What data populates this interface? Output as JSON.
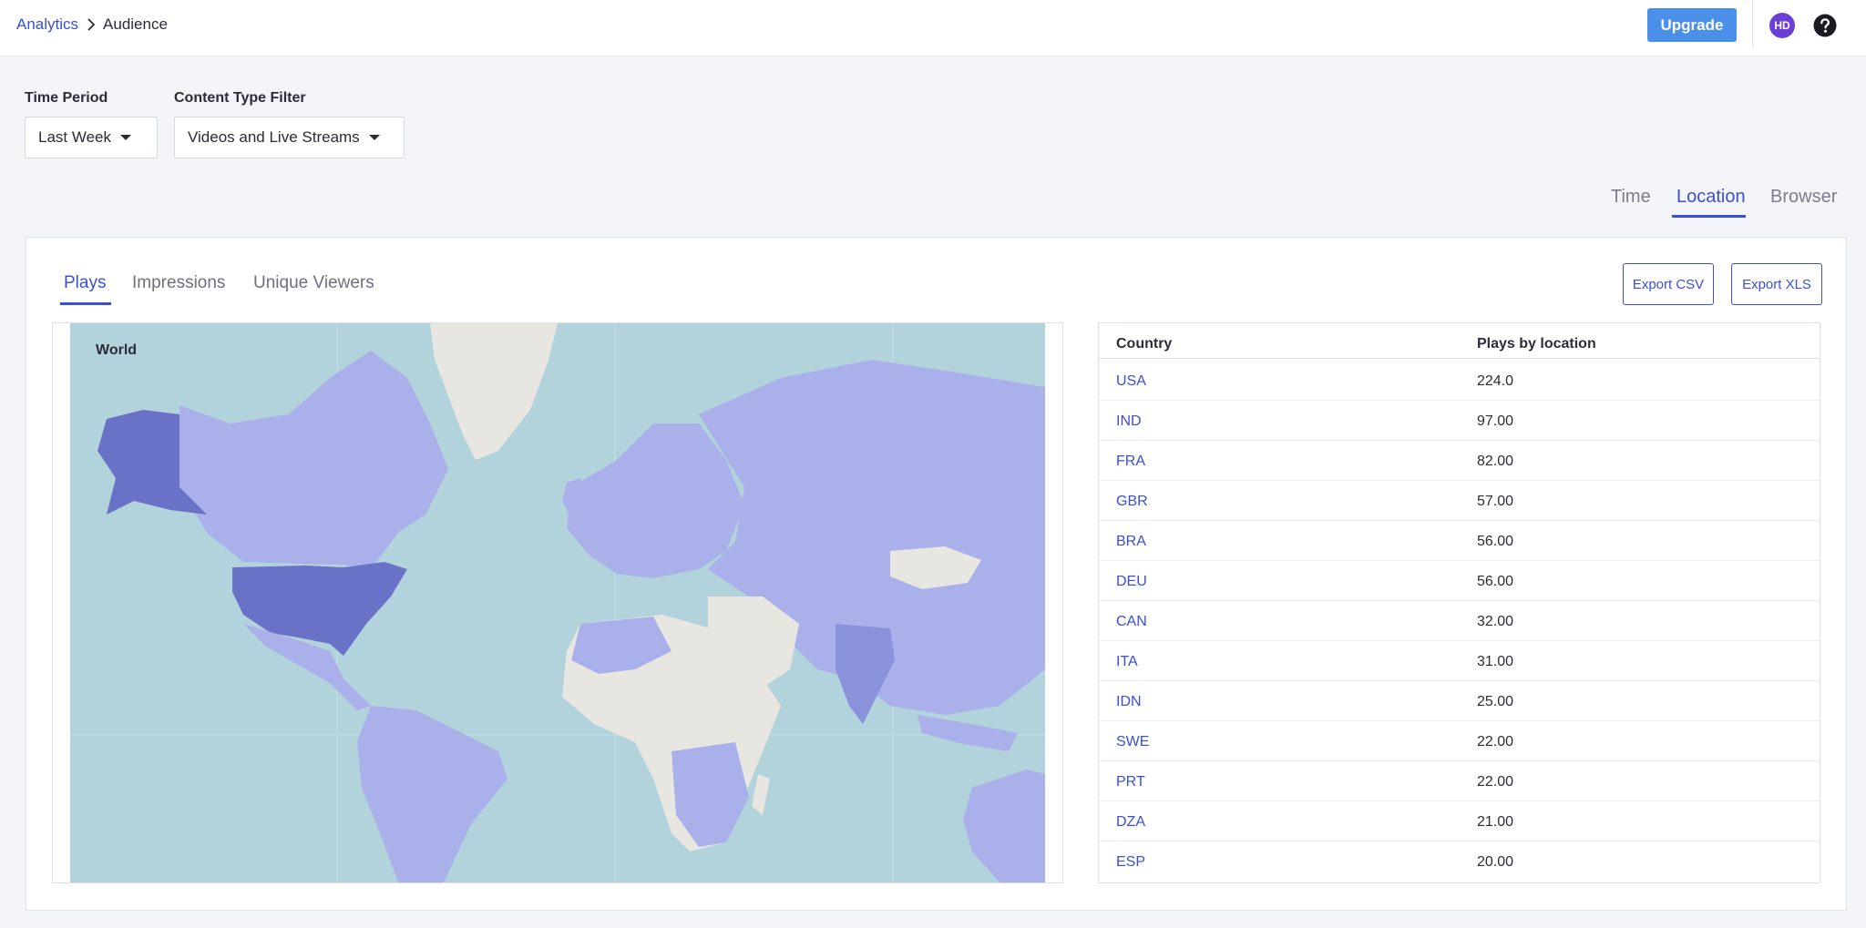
{
  "breadcrumb": {
    "root": "Analytics",
    "current": "Audience"
  },
  "header": {
    "upgrade_label": "Upgrade",
    "avatar_initials": "HD"
  },
  "filters": {
    "time_period": {
      "label": "Time Period",
      "value": "Last Week"
    },
    "content_type": {
      "label": "Content Type Filter",
      "value": "Videos and Live Streams"
    }
  },
  "view_tabs": {
    "items": [
      "Time",
      "Location",
      "Browser"
    ],
    "active": "Location"
  },
  "metric_tabs": {
    "items": [
      "Plays",
      "Impressions",
      "Unique Viewers"
    ],
    "active": "Plays"
  },
  "exports": {
    "csv": "Export CSV",
    "xls": "Export XLS"
  },
  "map": {
    "title": "World"
  },
  "table": {
    "headers": [
      "Country",
      "Plays by location"
    ],
    "rows": [
      {
        "country": "USA",
        "value": "224.0"
      },
      {
        "country": "IND",
        "value": "97.00"
      },
      {
        "country": "FRA",
        "value": "82.00"
      },
      {
        "country": "GBR",
        "value": "57.00"
      },
      {
        "country": "BRA",
        "value": "56.00"
      },
      {
        "country": "DEU",
        "value": "56.00"
      },
      {
        "country": "CAN",
        "value": "32.00"
      },
      {
        "country": "ITA",
        "value": "31.00"
      },
      {
        "country": "IDN",
        "value": "25.00"
      },
      {
        "country": "SWE",
        "value": "22.00"
      },
      {
        "country": "PRT",
        "value": "22.00"
      },
      {
        "country": "DZA",
        "value": "21.00"
      },
      {
        "country": "ESP",
        "value": "20.00"
      }
    ]
  },
  "colors": {
    "accent": "#3a4fd4",
    "upgrade": "#4a90e8",
    "ocean": "#b2d3dc",
    "land_no_data": "#e8e6e1",
    "land_low": "#aab0ea",
    "land_high": "#6a72c8"
  }
}
